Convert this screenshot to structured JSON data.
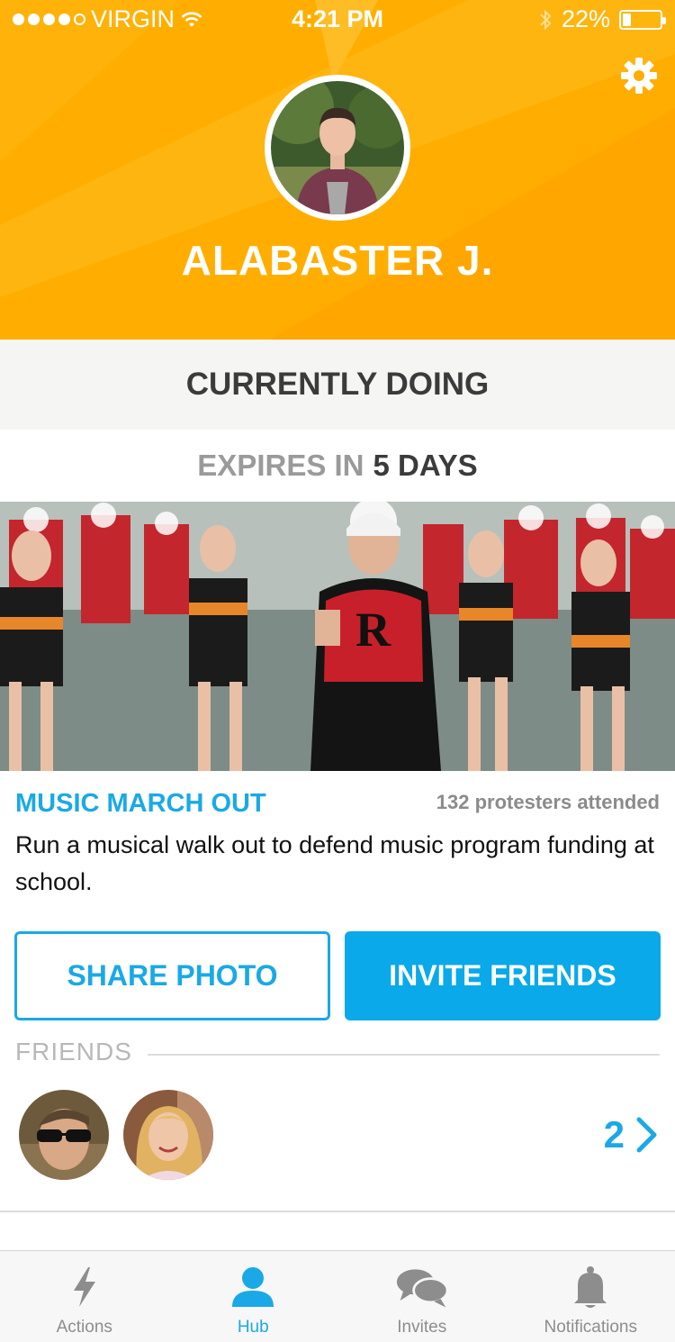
{
  "status_bar": {
    "carrier": "VIRGIN",
    "signal_bars": 4,
    "time": "4:21 PM",
    "battery_text": "22%",
    "battery_level": 0.22
  },
  "header": {
    "settings_icon": "gear-icon",
    "profile_name": "ALABASTER J."
  },
  "current": {
    "section_title": "CURRENTLY DOING",
    "expires_prefix": "EXPIRES IN",
    "expires_value": "5 DAYS"
  },
  "action": {
    "title": "MUSIC MARCH OUT",
    "attended": "132 protesters attended",
    "description": "Run a musical walk out to defend music program funding at school."
  },
  "buttons": {
    "share_photo": "SHARE PHOTO",
    "invite_friends": "INVITE FRIENDS"
  },
  "friends": {
    "label": "FRIENDS",
    "count": "2"
  },
  "tabs": [
    {
      "label": "Actions",
      "icon": "lightning-icon",
      "active": false
    },
    {
      "label": "Hub",
      "icon": "person-icon",
      "active": true
    },
    {
      "label": "Invites",
      "icon": "chat-bubbles-icon",
      "active": false
    },
    {
      "label": "Notifications",
      "icon": "bell-icon",
      "active": false
    }
  ],
  "colors": {
    "header_orange": "#ffae00",
    "accent_blue": "#1aa9e6",
    "tab_inactive": "#8d8d8d"
  }
}
